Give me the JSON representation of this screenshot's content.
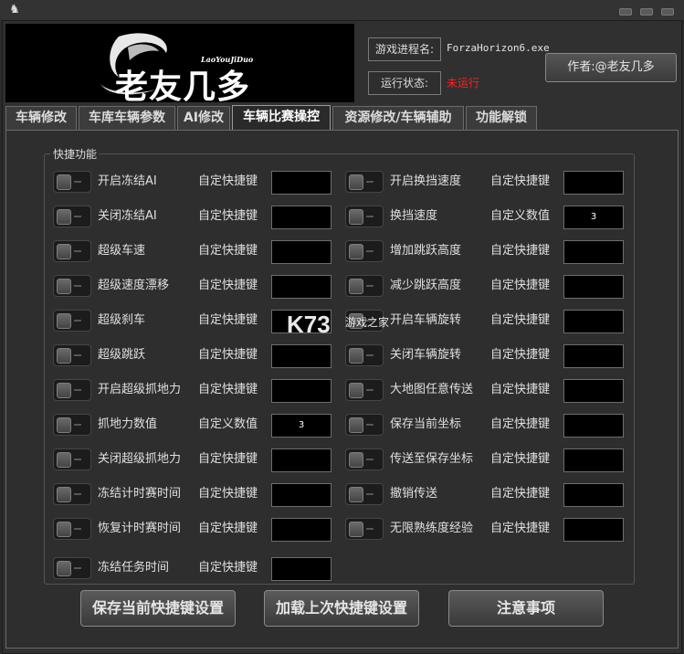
{
  "window": {
    "icon": "app-logo-icon"
  },
  "banner": {
    "logo_text": "老友几多",
    "logo_subtitle": "LaoYouJiDuo"
  },
  "info": {
    "process_label": "游戏进程名:",
    "process_value": "ForzaHorizon6.exe",
    "status_label": "运行状态:",
    "status_value": "未运行",
    "status_color": "#ff2020",
    "author_label": "作者:@老友几多"
  },
  "tabs": [
    "车辆修改",
    "车库车辆参数",
    "AI修改",
    "车辆比赛操控",
    "资源修改/车辆辅助",
    "功能解锁"
  ],
  "active_tab": "车辆比赛操控",
  "group_title": "快捷功能",
  "left_rows": [
    {
      "label": "开启冻结AI",
      "key_label": "自定快捷键",
      "value": ""
    },
    {
      "label": "关闭冻结AI",
      "key_label": "自定快捷键",
      "value": ""
    },
    {
      "label": "超级车速",
      "key_label": "自定快捷键",
      "value": ""
    },
    {
      "label": "超级速度漂移",
      "key_label": "自定快捷键",
      "value": ""
    },
    {
      "label": "超级刹车",
      "key_label": "自定快捷键",
      "value": ""
    },
    {
      "label": "超级跳跃",
      "key_label": "自定快捷键",
      "value": ""
    },
    {
      "label": "开启超级抓地力",
      "key_label": "自定快捷键",
      "value": ""
    },
    {
      "label": "抓地力数值",
      "key_label": "自定义数值",
      "value": "3"
    },
    {
      "label": "关闭超级抓地力",
      "key_label": "自定快捷键",
      "value": ""
    },
    {
      "label": "冻结计时赛时间",
      "key_label": "自定快捷键",
      "value": ""
    },
    {
      "label": "恢复计时赛时间",
      "key_label": "自定快捷键",
      "value": ""
    },
    {
      "label": "冻结任务时间",
      "key_label": "自定快捷键",
      "value": ""
    }
  ],
  "right_rows": [
    {
      "label": "开启换挡速度",
      "key_label": "自定快捷键",
      "value": ""
    },
    {
      "label": "换挡速度",
      "key_label": "自定义数值",
      "value": "3"
    },
    {
      "label": "增加跳跃高度",
      "key_label": "自定快捷键",
      "value": ""
    },
    {
      "label": "减少跳跃高度",
      "key_label": "自定快捷键",
      "value": ""
    },
    {
      "label": "开启车辆旋转",
      "key_label": "自定快捷键",
      "value": ""
    },
    {
      "label": "关闭车辆旋转",
      "key_label": "自定快捷键",
      "value": ""
    },
    {
      "label": "大地图任意传送",
      "key_label": "自定快捷键",
      "value": ""
    },
    {
      "label": "保存当前坐标",
      "key_label": "自定快捷键",
      "value": ""
    },
    {
      "label": "传送至保存坐标",
      "key_label": "自定快捷键",
      "value": ""
    },
    {
      "label": "撤销传送",
      "key_label": "自定快捷键",
      "value": ""
    },
    {
      "label": "无限熟练度经验",
      "key_label": "自定快捷键",
      "value": ""
    }
  ],
  "buttons": {
    "save": "保存当前快捷键设置",
    "load": "加载上次快捷键设置",
    "notes": "注意事项"
  },
  "watermark": {
    "brand": "K73",
    "text": "游戏之家"
  }
}
